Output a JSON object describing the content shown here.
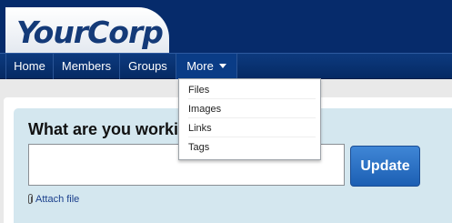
{
  "header": {
    "logo_text": "YourCorp"
  },
  "nav": {
    "items": [
      {
        "label": "Home"
      },
      {
        "label": "Members"
      },
      {
        "label": "Groups"
      },
      {
        "label": "More"
      }
    ]
  },
  "dropdown": {
    "items": [
      {
        "label": "Files"
      },
      {
        "label": "Images"
      },
      {
        "label": "Links"
      },
      {
        "label": "Tags"
      }
    ]
  },
  "composer": {
    "title": "What are you working on?",
    "input_value": "",
    "update_label": "Update",
    "attach_label": "Attach file",
    "attach_icon": "paperclip-icon"
  },
  "colors": {
    "header_bg": "#062b6b",
    "nav_bg": "#052a64",
    "panel_bg": "#d4e7ef",
    "button_bg": "#2a70c4",
    "logo_text": "#143a78"
  }
}
